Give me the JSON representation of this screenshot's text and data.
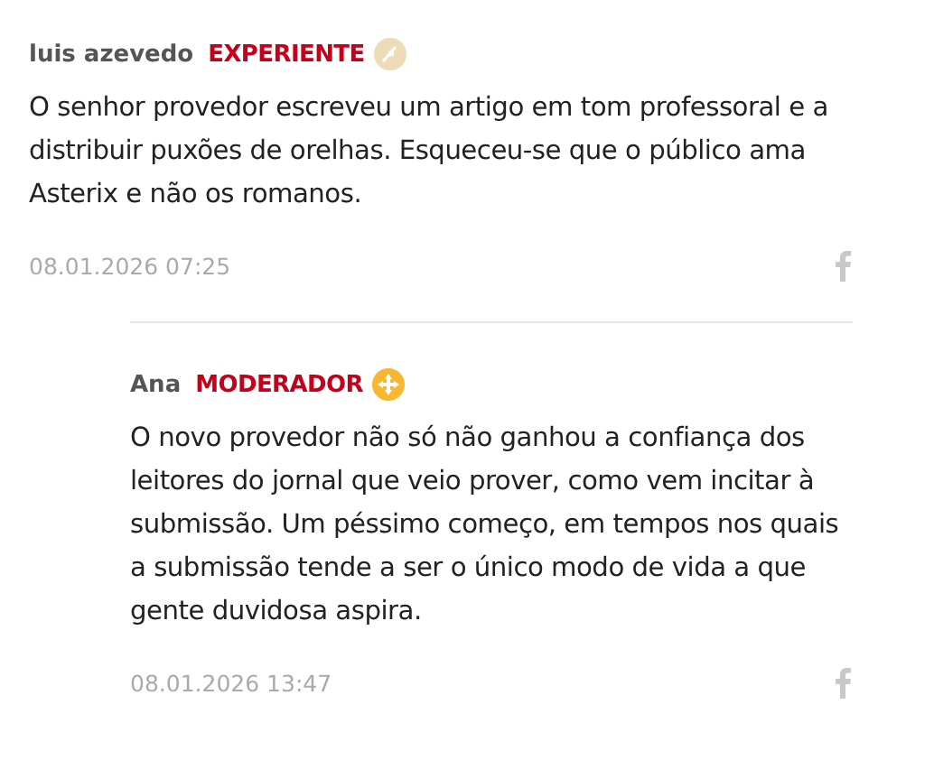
{
  "comments": [
    {
      "author": "luis azevedo",
      "badge": "EXPERIENTE",
      "kind": "experiente",
      "text": "O senhor provedor escreveu um artigo em tom professoral e a distribuir puxões de orelhas. Esqueceu-se que o público ama Asterix e não os romanos.",
      "date": "08.01.2026 07:25",
      "children": [
        {
          "author": "Ana",
          "badge": "MODERADOR",
          "kind": "moderador",
          "text": "O novo provedor não só não ganhou a confiança dos leitores do jornal que veio prover, como vem incitar à submissão. Um péssimo começo, em tempos nos quais a submissão tende a ser o único modo de vida a que gente duvidosa aspira.",
          "date": "08.01.2026 13:47"
        }
      ]
    }
  ]
}
